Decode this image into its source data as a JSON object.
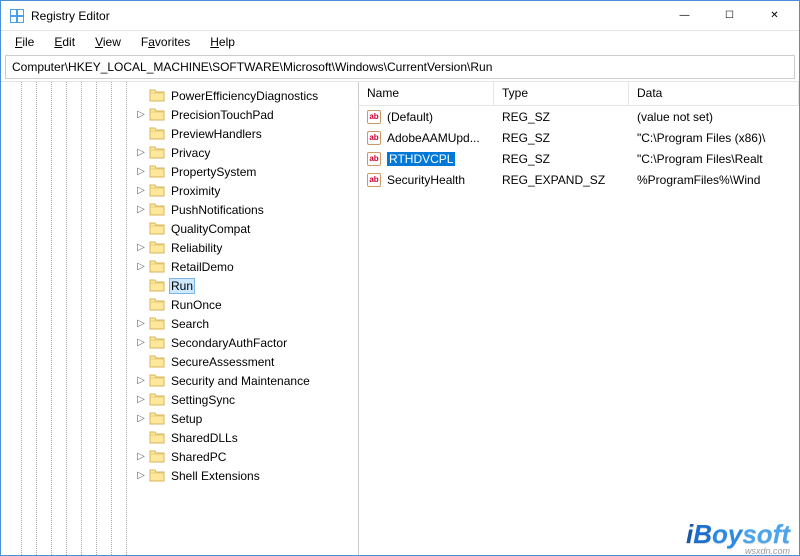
{
  "title": "Registry Editor",
  "window_controls": {
    "min": "—",
    "max": "☐",
    "close": "✕"
  },
  "menu": [
    {
      "accel": "F",
      "rest": "ile"
    },
    {
      "accel": "E",
      "rest": "dit"
    },
    {
      "accel": "V",
      "rest": "iew"
    },
    {
      "accel": "",
      "rest": "F",
      "accel2": "a",
      "rest2": "vorites"
    },
    {
      "accel": "H",
      "rest": "elp"
    }
  ],
  "address": "Computer\\HKEY_LOCAL_MACHINE\\SOFTWARE\\Microsoft\\Windows\\CurrentVersion\\Run",
  "guides": [
    20,
    35,
    50,
    65,
    80,
    95,
    110,
    125
  ],
  "tree": [
    {
      "label": "PowerEfficiencyDiagnostics",
      "exp": ""
    },
    {
      "label": "PrecisionTouchPad",
      "exp": ">"
    },
    {
      "label": "PreviewHandlers",
      "exp": ""
    },
    {
      "label": "Privacy",
      "exp": ">"
    },
    {
      "label": "PropertySystem",
      "exp": ">"
    },
    {
      "label": "Proximity",
      "exp": ">"
    },
    {
      "label": "PushNotifications",
      "exp": ">"
    },
    {
      "label": "QualityCompat",
      "exp": ""
    },
    {
      "label": "Reliability",
      "exp": ">"
    },
    {
      "label": "RetailDemo",
      "exp": ">"
    },
    {
      "label": "Run",
      "exp": "",
      "selected": true
    },
    {
      "label": "RunOnce",
      "exp": ""
    },
    {
      "label": "Search",
      "exp": ">"
    },
    {
      "label": "SecondaryAuthFactor",
      "exp": ">"
    },
    {
      "label": "SecureAssessment",
      "exp": ""
    },
    {
      "label": "Security and Maintenance",
      "exp": ">"
    },
    {
      "label": "SettingSync",
      "exp": ">"
    },
    {
      "label": "Setup",
      "exp": ">"
    },
    {
      "label": "SharedDLLs",
      "exp": ""
    },
    {
      "label": "SharedPC",
      "exp": ">"
    },
    {
      "label": "Shell Extensions",
      "exp": ">",
      "cut": true
    }
  ],
  "columns": {
    "name": "Name",
    "type": "Type",
    "data": "Data"
  },
  "values": [
    {
      "name": "(Default)",
      "type": "REG_SZ",
      "data": "(value not set)"
    },
    {
      "name": "AdobeAAMUpd...",
      "type": "REG_SZ",
      "data": "\"C:\\Program Files (x86)\\"
    },
    {
      "name": "RTHDVCPL",
      "type": "REG_SZ",
      "data": "\"C:\\Program Files\\Realt",
      "selected": true
    },
    {
      "name": "SecurityHealth",
      "type": "REG_EXPAND_SZ",
      "data": "%ProgramFiles%\\Wind"
    }
  ],
  "watermark": {
    "i": "i",
    "b": "B",
    "oy": "oy",
    "soft": "soft"
  },
  "wsx": "wsxdn.com"
}
